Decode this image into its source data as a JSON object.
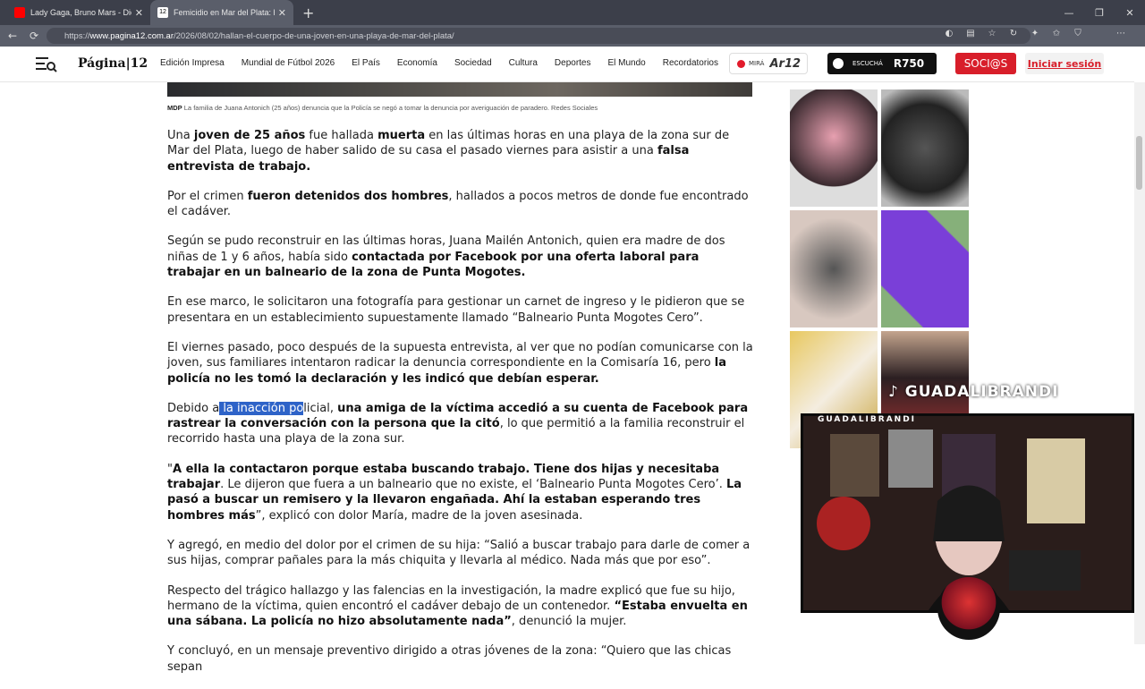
{
  "browser": {
    "tabs": [
      {
        "title": "Lady Gaga, Bruno Mars - Die",
        "favicon_color": "#ff0000",
        "active": false
      },
      {
        "title": "Femicidio en Mar del Plata: hallan",
        "favicon_color": "#ffffff",
        "active": true
      }
    ],
    "new_tab": "+",
    "url_prefix": "https://",
    "url_domain": "www.pagina12.com.ar",
    "url_path": "/2026/08/02/hallan-el-cuerpo-de-una-joven-en-una-playa-de-mar-del-plata/"
  },
  "site": {
    "logo": "Página|12",
    "nav": [
      "Edición Impresa",
      "Mundial de Fútbol 2026",
      "El País",
      "Economía",
      "Sociedad",
      "Cultura",
      "Deportes",
      "El Mundo",
      "Recordatorios"
    ],
    "live_label": "MIRÁ",
    "live_brand": "Ar12",
    "radio_label": "ESCUCHÁ",
    "radio_brand": "R750",
    "socios": "SOCI@S",
    "login": "Iniciar sesión"
  },
  "caption": {
    "source": "MDP",
    "text": "La familia de Juana Antonich (25 años) denuncia que la Policía se negó a tomar la denuncia por averiguación de paradero. Redes Sociales"
  },
  "paragraphs": [
    [
      {
        "t": "Una "
      },
      {
        "t": "joven de 25 años",
        "b": true
      },
      {
        "t": " fue hallada "
      },
      {
        "t": "muerta",
        "b": true
      },
      {
        "t": " en las últimas horas en una playa de la zona sur de Mar del Plata, luego de haber salido de su casa el pasado viernes para asistir a una "
      },
      {
        "t": "falsa entrevista de trabajo.",
        "b": true
      }
    ],
    [
      {
        "t": "Por el crimen "
      },
      {
        "t": "fueron detenidos dos hombres",
        "b": true
      },
      {
        "t": ", hallados a pocos metros de donde fue encontrado el cadáver."
      }
    ],
    [
      {
        "t": "Según se pudo reconstruir en las últimas horas, Juana Mailén Antonich, quien era madre de dos niñas de 1 y 6 años, había sido "
      },
      {
        "t": "contactada por Facebook por una oferta laboral para trabajar en un balneario de la zona de Punta Mogotes.",
        "b": true
      }
    ],
    [
      {
        "t": "En ese marco, le solicitaron una fotografía para gestionar un carnet de ingreso y le pidieron que se presentara en un establecimiento supuestamente llamado “Balneario Punta Mogotes Cero”."
      }
    ],
    [
      {
        "t": "El viernes pasado, poco después de la supuesta entrevista, al ver que no podían comunicarse con la joven, sus familiares intentaron radicar la denuncia correspondiente en la Comisaría 16, pero "
      },
      {
        "t": "la policía no les tomó la declaración y les indicó que debían esperar.",
        "b": true
      }
    ],
    [
      {
        "t": "Debido a"
      },
      {
        "t": " la inacción po",
        "s": true
      },
      {
        "t": "licial, "
      },
      {
        "t": "una amiga de la víctima accedió a su cuenta de Facebook para rastrear la conversación con la persona que la citó",
        "b": true
      },
      {
        "t": ", lo que permitió a la familia reconstruir el recorrido hasta una playa de la zona sur."
      }
    ],
    [
      {
        "t": "\""
      },
      {
        "t": "A ella la contactaron porque estaba buscando trabajo. Tiene dos hijas y necesitaba trabajar",
        "b": true
      },
      {
        "t": ". Le dijeron que fuera a un balneario que no existe, el ‘Balneario Punta Mogotes Cero’. "
      },
      {
        "t": "La pasó a buscar un remisero y la llevaron engañada. Ahí la estaban esperando tres hombres más",
        "b": true
      },
      {
        "t": "”, explicó con dolor María, madre de la joven asesinada."
      }
    ],
    [
      {
        "t": "Y agregó, en medio del dolor por el crimen de su hija: “Salió a buscar trabajo para darle de comer a sus hijas, comprar pañales para la más chiquita y llevarla al médico. Nada más que por eso”."
      }
    ],
    [
      {
        "t": "Respecto del trágico hallazgo y las falencias en la investigación, la madre explicó que fue su hijo, hermano de la víctima, quien encontró el cadáver debajo de un contenedor. "
      },
      {
        "t": "“Estaba envuelta en una sábana. La policía no hizo absolutamente nada”",
        "b": true
      },
      {
        "t": ", denunció la mujer."
      }
    ],
    [
      {
        "t": "Y concluyó, en un mensaje preventivo dirigido a otras jóvenes de la zona: “Quiero que las chicas sepan"
      }
    ]
  ],
  "overlay": {
    "tiktok_handle": "GUADALIBRANDI",
    "cam_label": "GUADALIBRANDI"
  },
  "colors": {
    "brand_red": "#d81e2a",
    "selection": "#2e63c8"
  }
}
